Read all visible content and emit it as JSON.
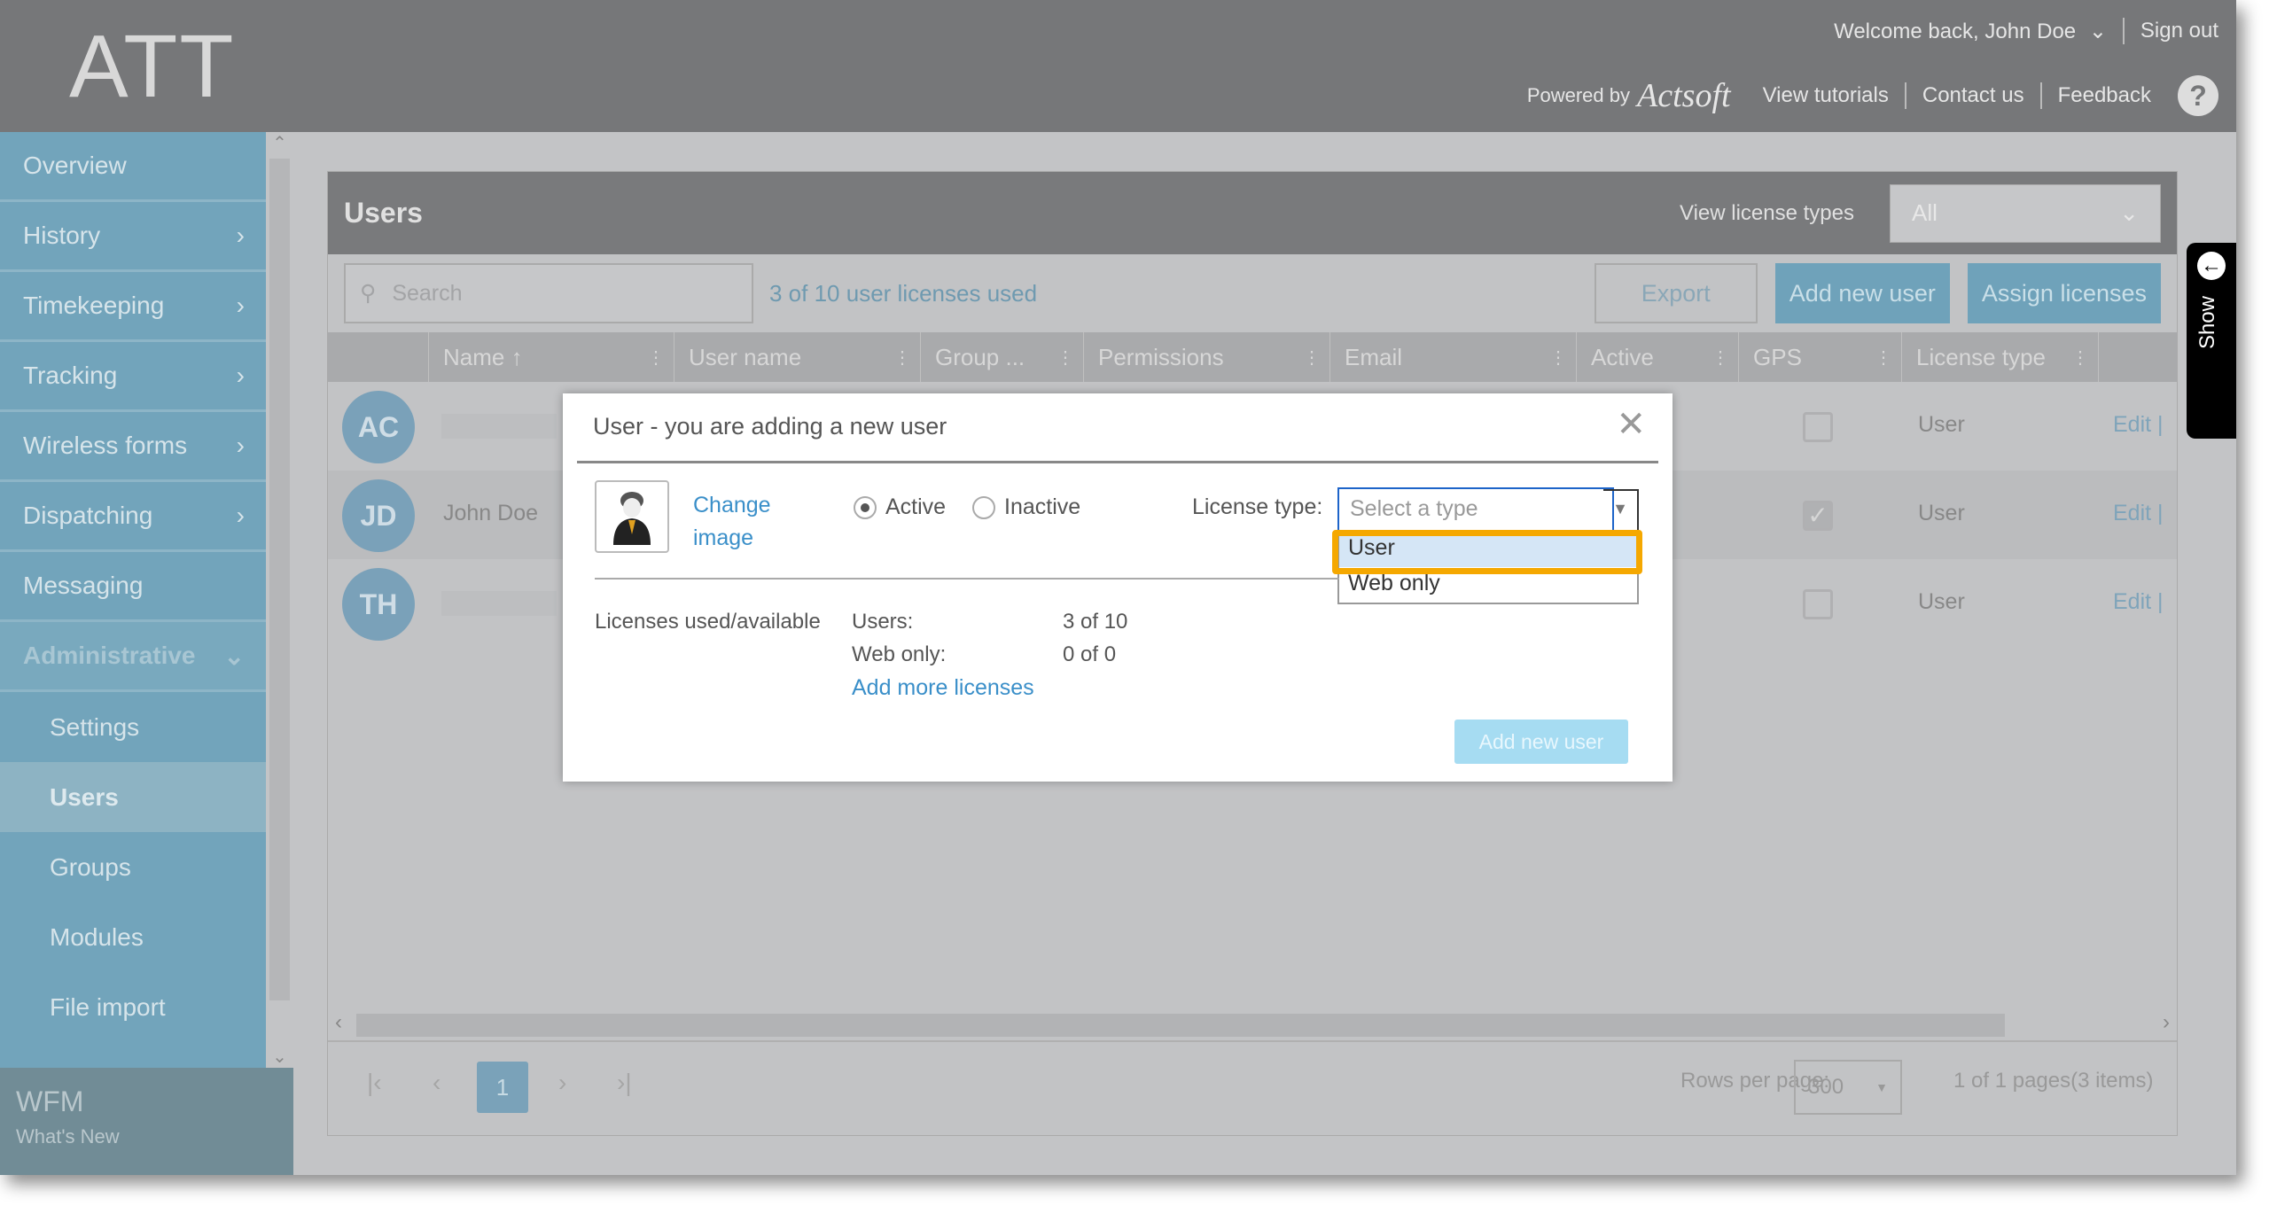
{
  "header": {
    "logo": "ATT",
    "welcome": "Welcome back, John Doe",
    "sign_out": "Sign out",
    "powered_by": "Powered by",
    "brand": "Actsoft",
    "view_tutorials": "View tutorials",
    "contact_us": "Contact us",
    "feedback": "Feedback",
    "help": "?"
  },
  "sidebar": {
    "items": [
      {
        "label": "Overview"
      },
      {
        "label": "History"
      },
      {
        "label": "Timekeeping"
      },
      {
        "label": "Tracking"
      },
      {
        "label": "Wireless forms"
      },
      {
        "label": "Dispatching"
      },
      {
        "label": "Messaging"
      }
    ],
    "admin": "Administrative",
    "sub": [
      {
        "label": "Settings"
      },
      {
        "label": "Users"
      },
      {
        "label": "Groups"
      },
      {
        "label": "Modules"
      },
      {
        "label": "File import"
      }
    ],
    "footer_title": "WFM",
    "footer_sub": "What's New"
  },
  "panel": {
    "title": "Users",
    "view_license_label": "View license types",
    "view_license_value": "All",
    "search_placeholder": "Search",
    "licenses_used": "3 of 10 user licenses used",
    "export": "Export",
    "add_new_user": "Add new user",
    "assign_licenses": "Assign licenses"
  },
  "columns": [
    "Name ↑",
    "User name",
    "Group ...",
    "Permissions",
    "Email",
    "Active",
    "GPS",
    "License type"
  ],
  "rows": [
    {
      "initials": "AC",
      "name": "",
      "gps": false,
      "license": "User",
      "edit": "Edit"
    },
    {
      "initials": "JD",
      "name": "John Doe",
      "gps": true,
      "license": "User",
      "edit": "Edit"
    },
    {
      "initials": "TH",
      "name": "",
      "gps": false,
      "license": "User",
      "edit": "Edit"
    }
  ],
  "pager": {
    "page": "1",
    "rows_per_page_label": "Rows per page:",
    "rows_per_page": "300",
    "info": "1 of 1 pages(3 items)"
  },
  "show_tab": "Show",
  "modal": {
    "title": "User - you are adding a new user",
    "change_image": "Change image",
    "active": "Active",
    "inactive": "Inactive",
    "status": "Active",
    "license_type_label": "License type:",
    "select_placeholder": "Select a type",
    "options": [
      "User",
      "Web only"
    ],
    "highlighted_option": "User",
    "licenses_label": "Licenses used/available",
    "users_label": "Users:",
    "users_value": "3 of 10",
    "web_label": "Web only:",
    "web_value": "0 of 0",
    "add_more": "Add more licenses",
    "submit": "Add new user"
  },
  "colors": {
    "accent": "#3a8fc9",
    "highlight": "#f5a800",
    "sidebar": "#72a4bb"
  }
}
